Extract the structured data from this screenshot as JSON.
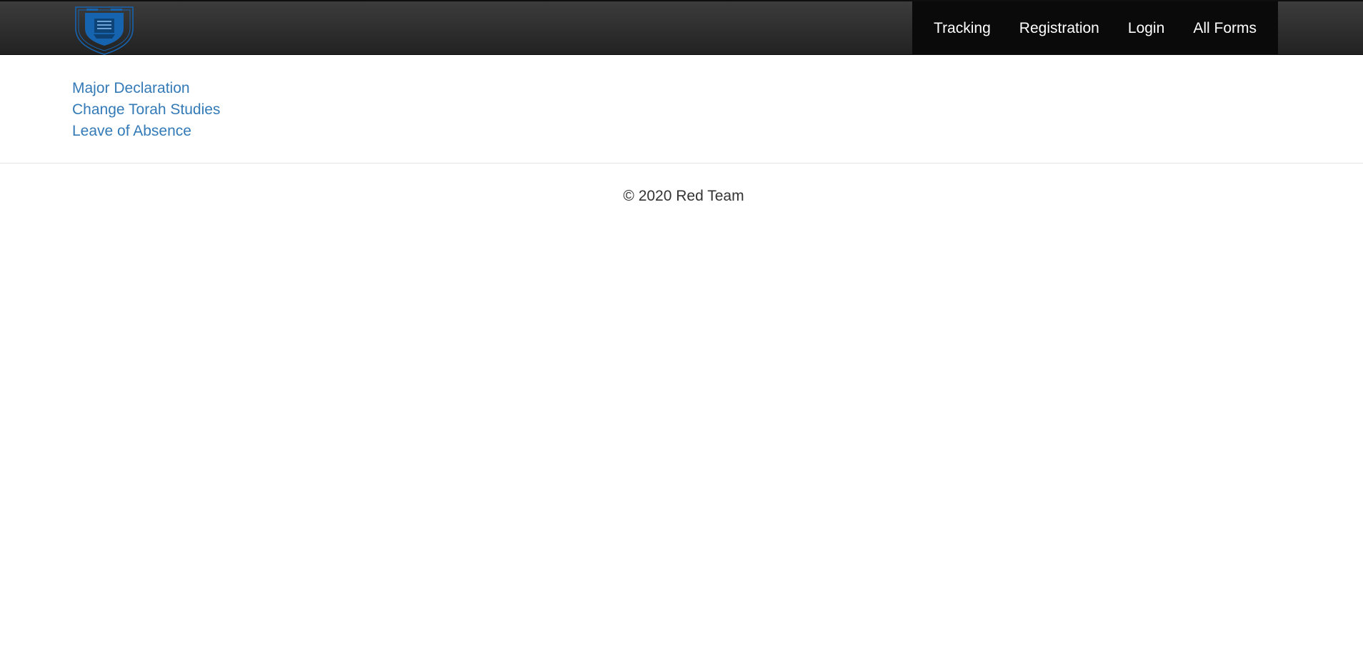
{
  "nav": {
    "logo_icon": "university-shield-logo-icon",
    "links": [
      {
        "label": "Tracking"
      },
      {
        "label": "Registration"
      },
      {
        "label": "Login"
      },
      {
        "label": "All Forms"
      }
    ]
  },
  "forms": [
    {
      "label": "Major Declaration"
    },
    {
      "label": "Change Torah Studies"
    },
    {
      "label": "Leave of Absence"
    }
  ],
  "footer": {
    "text": "© 2020 Red Team"
  },
  "colors": {
    "navbar": "#222222",
    "nav_active_bg": "#0a0a0a",
    "link": "#337ab7",
    "logo_blue": "#1663b0"
  }
}
